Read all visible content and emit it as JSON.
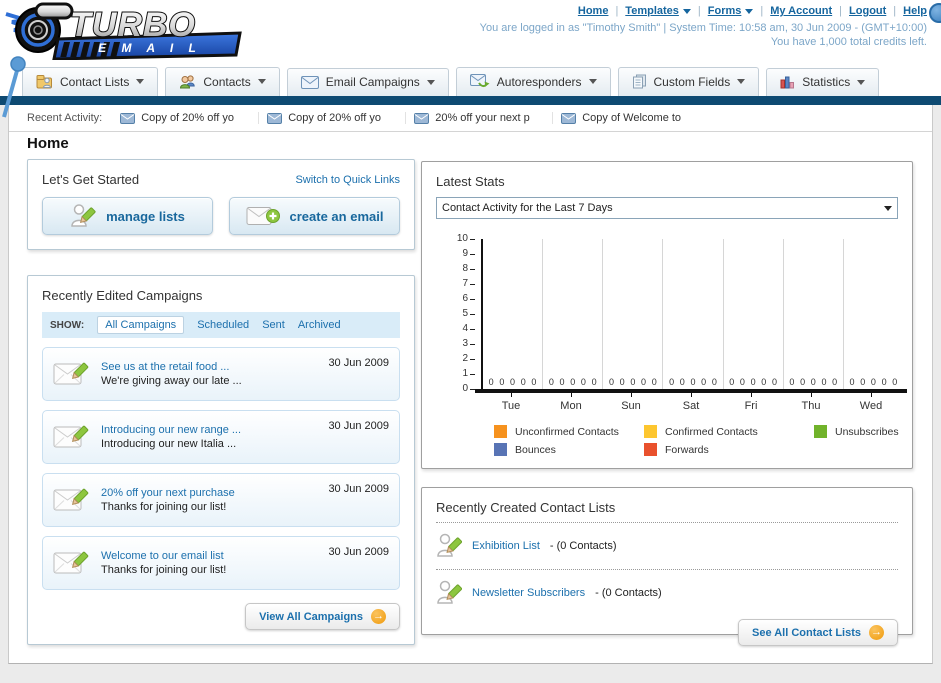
{
  "header": {
    "nav": [
      "Home",
      "Templates",
      "Forms",
      "My Account",
      "Logout",
      "Help"
    ],
    "login_info": "You are logged in as \"Timothy Smith\" | System Time: 10:58 am, 30 Jun 2009 - (GMT+10:00)",
    "credits_info": "You have 1,000 total credits left.",
    "logo": {
      "line1": "TURBO",
      "line2": "E M A I L"
    }
  },
  "tabs": [
    "Contact Lists",
    "Contacts",
    "Email Campaigns",
    "Autoresponders",
    "Custom Fields",
    "Statistics"
  ],
  "recent_activity": {
    "label": "Recent Activity:",
    "items": [
      "Copy of 20% off yo",
      "Copy of 20% off yo",
      "20% off your next p",
      "Copy of Welcome to"
    ]
  },
  "page_title": "Home",
  "get_started": {
    "title": "Let's Get Started",
    "switch_link": "Switch to Quick Links",
    "buttons": [
      {
        "label": "manage lists"
      },
      {
        "label": "create an email"
      }
    ]
  },
  "campaigns": {
    "title": "Recently Edited Campaigns",
    "show_label": "SHOW:",
    "filters": [
      "All Campaigns",
      "Scheduled",
      "Sent",
      "Archived"
    ],
    "items": [
      {
        "title": "See us at the retail food ...",
        "subtitle": "We're giving away our late ...",
        "date": "30 Jun 2009"
      },
      {
        "title": "Introducing our new range ...",
        "subtitle": "Introducing our new Italia ...",
        "date": "30 Jun 2009"
      },
      {
        "title": "20% off your next purchase",
        "subtitle": "Thanks for joining our list!",
        "date": "30 Jun 2009"
      },
      {
        "title": "Welcome to our email list",
        "subtitle": "Thanks for joining our list!",
        "date": "30 Jun 2009"
      }
    ],
    "view_all": "View All Campaigns"
  },
  "latest_stats": {
    "title": "Latest Stats",
    "dropdown_value": "Contact Activity for the Last 7 Days"
  },
  "chart_data": {
    "type": "bar",
    "title": "Contact Activity for the Last 7 Days",
    "categories": [
      "Tue",
      "Mon",
      "Sun",
      "Sat",
      "Fri",
      "Thu",
      "Wed"
    ],
    "series": [
      {
        "name": "Unconfirmed Contacts",
        "color": "#f6921e",
        "values": [
          0,
          0,
          0,
          0,
          0,
          0,
          0
        ]
      },
      {
        "name": "Confirmed Contacts",
        "color": "#fdc62f",
        "values": [
          0,
          0,
          0,
          0,
          0,
          0,
          0
        ]
      },
      {
        "name": "Unsubscribes",
        "color": "#71b32b",
        "values": [
          0,
          0,
          0,
          0,
          0,
          0,
          0
        ]
      },
      {
        "name": "Bounces",
        "color": "#5874b5",
        "values": [
          0,
          0,
          0,
          0,
          0,
          0,
          0
        ]
      },
      {
        "name": "Forwards",
        "color": "#e9512d",
        "values": [
          0,
          0,
          0,
          0,
          0,
          0,
          0
        ]
      }
    ],
    "ylim": [
      0,
      10
    ],
    "yticks": [
      0,
      1,
      2,
      3,
      4,
      5,
      6,
      7,
      8,
      9,
      10
    ],
    "grid": "vertical-between-groups",
    "legend_position": "bottom",
    "value_labels_shown": true
  },
  "contact_lists": {
    "title": "Recently Created Contact Lists",
    "items": [
      {
        "name": "Exhibition List",
        "suffix": "- (0 Contacts)"
      },
      {
        "name": "Newsletter Subscribers",
        "suffix": "- (0 Contacts)"
      }
    ],
    "see_all": "See All Contact Lists"
  },
  "colors": {
    "navy_bar": "#0e4a72",
    "link_blue": "#1c70ad",
    "header_info_blue": "#7ca6c8",
    "arrow_button_orange": "#ef9a0c",
    "edit_pencil_green": "#8dc63f"
  }
}
